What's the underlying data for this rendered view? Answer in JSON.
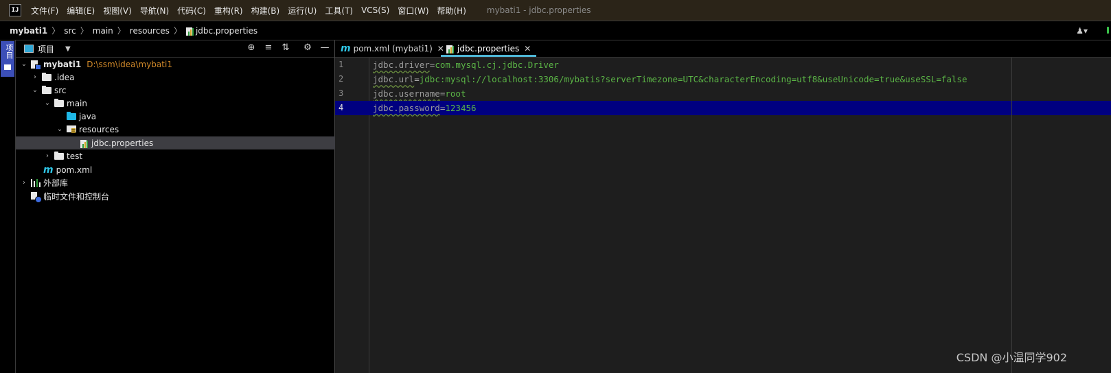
{
  "menubar": {
    "items": [
      "文件(F)",
      "编辑(E)",
      "视图(V)",
      "导航(N)",
      "代码(C)",
      "重构(R)",
      "构建(B)",
      "运行(U)",
      "工具(T)",
      "VCS(S)",
      "窗口(W)",
      "帮助(H)"
    ],
    "window_title": "mybati1 - jdbc.properties"
  },
  "breadcrumb": [
    "mybati1",
    "src",
    "main",
    "resources",
    "jdbc.properties"
  ],
  "toolstrip": {
    "project_tab_label": "项目"
  },
  "project_panel": {
    "title": "项目",
    "tree": [
      {
        "label": "mybati1",
        "path": "D:\\ssm\\idea\\mybati1",
        "icon": "module-icon",
        "expanded": true
      },
      {
        "label": ".idea",
        "icon": "folder-icon",
        "expanded": false
      },
      {
        "label": "src",
        "icon": "folder-icon",
        "expanded": true
      },
      {
        "label": "main",
        "icon": "folder-icon",
        "expanded": true
      },
      {
        "label": "java",
        "icon": "source-folder-icon"
      },
      {
        "label": "resources",
        "icon": "resources-folder-icon",
        "expanded": true
      },
      {
        "label": "jdbc.properties",
        "icon": "properties-file-icon",
        "selected": true
      },
      {
        "label": "test",
        "icon": "folder-icon",
        "expanded": false
      },
      {
        "label": "pom.xml",
        "icon": "maven-icon"
      },
      {
        "label": "外部库",
        "icon": "library-icon",
        "expanded": false
      },
      {
        "label": "临时文件和控制台",
        "icon": "scratch-icon"
      }
    ]
  },
  "editor": {
    "tabs": [
      {
        "label": "pom.xml (mybati1)",
        "icon": "maven-icon",
        "active": false
      },
      {
        "label": "jdbc.properties",
        "icon": "properties-file-icon",
        "active": true
      }
    ],
    "lines": [
      {
        "num": "1",
        "key": "jdbc.driver",
        "value": "com.mysql.cj.jdbc.Driver"
      },
      {
        "num": "2",
        "key": "jdbc.url",
        "value": "jdbc:mysql://localhost:3306/mybatis?serverTimezone=UTC&characterEncoding=utf8&useUnicode=true&useSSL=false"
      },
      {
        "num": "3",
        "key": "jdbc.username",
        "value": "root"
      },
      {
        "num": "4",
        "key": "jdbc.password",
        "value": "123456",
        "current": true
      }
    ]
  },
  "watermark": "CSDN @小温同学902",
  "colors": {
    "menubar_bg": "#2b2418",
    "project_tab": "#3c4fb8",
    "current_line": "#000080",
    "value_green": "#5bb546",
    "path_orange": "#d28a2a",
    "tab_underline": "#4fb7d6"
  }
}
